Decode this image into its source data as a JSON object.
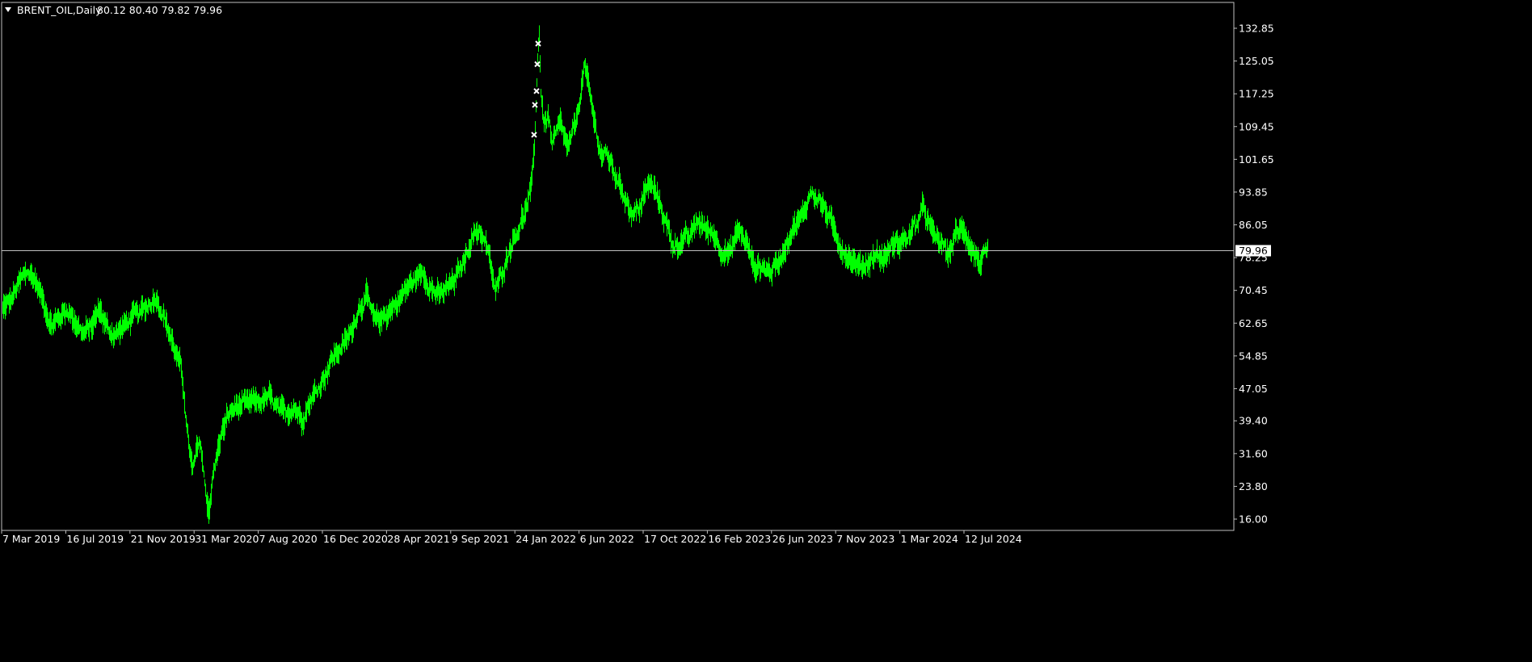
{
  "header": {
    "symbol": "BRENT_OIL,Daily",
    "ohlc": "80.12 80.40 79.82 79.96"
  },
  "colors": {
    "background": "#000000",
    "series": "#00ff00",
    "axis": "#c0c0c0",
    "text": "#ffffff",
    "current_price_line": "#c0c0c0",
    "markers": "#ffffff"
  },
  "chart_data": {
    "type": "line",
    "title": "BRENT_OIL,Daily",
    "xlabel": "",
    "ylabel": "",
    "ylim": [
      12.5,
      141.5
    ],
    "grid": false,
    "y_ticks": [
      "132.85",
      "125.05",
      "117.25",
      "109.45",
      "101.65",
      "93.85",
      "86.05",
      "78.25",
      "70.45",
      "62.65",
      "54.85",
      "47.05",
      "39.40",
      "31.60",
      "23.80",
      "16.00"
    ],
    "x_ticks": [
      "7 Mar 2019",
      "16 Jul 2019",
      "21 Nov 2019",
      "31 Mar 2020",
      "7 Aug 2020",
      "16 Dec 2020",
      "28 Apr 2021",
      "9 Sep 2021",
      "24 Jan 2022",
      "6 Jun 2022",
      "17 Oct 2022",
      "16 Feb 2023",
      "26 Jun 2023",
      "7 Nov 2023",
      "1 Mar 2024",
      "12 Jul 2024"
    ],
    "current_price": "79.96",
    "series": [
      {
        "values": [
          [
            0,
            66
          ],
          [
            10,
            68
          ],
          [
            20,
            72
          ],
          [
            30,
            75
          ],
          [
            40,
            73
          ],
          [
            50,
            68
          ],
          [
            60,
            62
          ],
          [
            70,
            64
          ],
          [
            80,
            66
          ],
          [
            90,
            63
          ],
          [
            100,
            60
          ],
          [
            110,
            62
          ],
          [
            120,
            66
          ],
          [
            130,
            61
          ],
          [
            140,
            60
          ],
          [
            150,
            62
          ],
          [
            160,
            64
          ],
          [
            170,
            65
          ],
          [
            180,
            67
          ],
          [
            190,
            69
          ],
          [
            200,
            64
          ],
          [
            210,
            58
          ],
          [
            220,
            52
          ],
          [
            225,
            45
          ],
          [
            228,
            37
          ],
          [
            235,
            27
          ],
          [
            240,
            32
          ],
          [
            245,
            34
          ],
          [
            250,
            24
          ],
          [
            255,
            18
          ],
          [
            260,
            26
          ],
          [
            265,
            31
          ],
          [
            270,
            36
          ],
          [
            280,
            41
          ],
          [
            290,
            43
          ],
          [
            300,
            43
          ],
          [
            310,
            44
          ],
          [
            320,
            44
          ],
          [
            330,
            45
          ],
          [
            340,
            42
          ],
          [
            350,
            41
          ],
          [
            360,
            43
          ],
          [
            370,
            40
          ],
          [
            380,
            44
          ],
          [
            390,
            47
          ],
          [
            400,
            51
          ],
          [
            410,
            55
          ],
          [
            420,
            57
          ],
          [
            430,
            60
          ],
          [
            440,
            66
          ],
          [
            450,
            69
          ],
          [
            460,
            63
          ],
          [
            470,
            64
          ],
          [
            480,
            66
          ],
          [
            490,
            68
          ],
          [
            500,
            71
          ],
          [
            510,
            73
          ],
          [
            520,
            75
          ],
          [
            530,
            71
          ],
          [
            540,
            69
          ],
          [
            550,
            71
          ],
          [
            560,
            73
          ],
          [
            570,
            77
          ],
          [
            580,
            83
          ],
          [
            590,
            85
          ],
          [
            600,
            80
          ],
          [
            605,
            75
          ],
          [
            610,
            70
          ],
          [
            620,
            76
          ],
          [
            630,
            82
          ],
          [
            640,
            86
          ],
          [
            650,
            91
          ],
          [
            655,
            96
          ],
          [
            658,
            105
          ],
          [
            660,
            115
          ],
          [
            662,
            125
          ],
          [
            664,
            132
          ],
          [
            666,
            118
          ],
          [
            670,
            110
          ],
          [
            675,
            112
          ],
          [
            680,
            105
          ],
          [
            690,
            110
          ],
          [
            700,
            104
          ],
          [
            710,
            111
          ],
          [
            720,
            124
          ],
          [
            730,
            113
          ],
          [
            740,
            103
          ],
          [
            750,
            102
          ],
          [
            760,
            97
          ],
          [
            770,
            93
          ],
          [
            780,
            88
          ],
          [
            790,
            91
          ],
          [
            800,
            96
          ],
          [
            810,
            93
          ],
          [
            820,
            87
          ],
          [
            830,
            81
          ],
          [
            840,
            82
          ],
          [
            850,
            83
          ],
          [
            860,
            87
          ],
          [
            870,
            85
          ],
          [
            880,
            84
          ],
          [
            890,
            80
          ],
          [
            900,
            79
          ],
          [
            910,
            85
          ],
          [
            920,
            82
          ],
          [
            930,
            76
          ],
          [
            940,
            76
          ],
          [
            950,
            75
          ],
          [
            960,
            77
          ],
          [
            970,
            82
          ],
          [
            980,
            86
          ],
          [
            990,
            88
          ],
          [
            1000,
            94
          ],
          [
            1010,
            92
          ],
          [
            1020,
            89
          ],
          [
            1030,
            84
          ],
          [
            1040,
            80
          ],
          [
            1050,
            78
          ],
          [
            1060,
            76
          ],
          [
            1070,
            77
          ],
          [
            1080,
            79
          ],
          [
            1090,
            78
          ],
          [
            1100,
            81
          ],
          [
            1110,
            82
          ],
          [
            1120,
            83
          ],
          [
            1130,
            86
          ],
          [
            1140,
            90
          ],
          [
            1150,
            84
          ],
          [
            1160,
            82
          ],
          [
            1170,
            79
          ],
          [
            1180,
            84
          ],
          [
            1190,
            85
          ],
          [
            1200,
            80
          ],
          [
            1210,
            77
          ],
          [
            1220,
            80
          ]
        ]
      }
    ],
    "markers": [
      {
        "x": 663,
        "y": 129.2
      },
      {
        "x": 662,
        "y": 124.3
      },
      {
        "x": 661,
        "y": 117.9
      },
      {
        "x": 659,
        "y": 114.6
      },
      {
        "x": 658,
        "y": 107.5
      }
    ]
  }
}
